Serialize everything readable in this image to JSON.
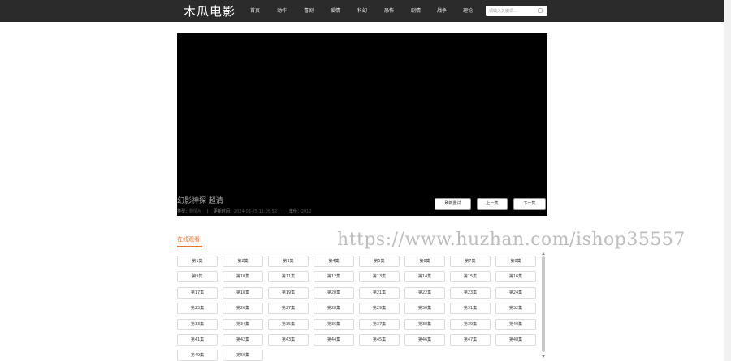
{
  "header": {
    "logo": "木瓜电影",
    "nav": [
      "首页",
      "动作",
      "喜剧",
      "爱情",
      "科幻",
      "恐怖",
      "剧情",
      "战争",
      "理论"
    ],
    "search": {
      "placeholder": "请输入关键词..."
    }
  },
  "player": {
    "title": "幻影神探 超清",
    "meta": {
      "type_label": "类型：",
      "type_value": "剧情片",
      "update_label": "更新时间：",
      "update_value": "2024-03-25 11:05:52",
      "year_label": "年份：",
      "year_value": "2012",
      "separator": "|"
    },
    "buttons": {
      "refresh": "刷新重试",
      "prev": "上一集",
      "next": "下一集"
    }
  },
  "section": {
    "title": "在线观看"
  },
  "watermark": "https://www.huzhan.com/ishop35557",
  "episodes": [
    "第1集",
    "第2集",
    "第3集",
    "第4集",
    "第5集",
    "第6集",
    "第7集",
    "第8集",
    "第9集",
    "第10集",
    "第11集",
    "第12集",
    "第13集",
    "第14集",
    "第15集",
    "第16集",
    "第17集",
    "第18集",
    "第19集",
    "第20集",
    "第21集",
    "第22集",
    "第23集",
    "第24集",
    "第25集",
    "第26集",
    "第27集",
    "第28集",
    "第29集",
    "第30集",
    "第31集",
    "第32集",
    "第33集",
    "第34集",
    "第35集",
    "第36集",
    "第37集",
    "第38集",
    "第39集",
    "第40集",
    "第41集",
    "第42集",
    "第43集",
    "第44集",
    "第45集",
    "第46集",
    "第47集",
    "第48集",
    "第49集",
    "第50集"
  ]
}
